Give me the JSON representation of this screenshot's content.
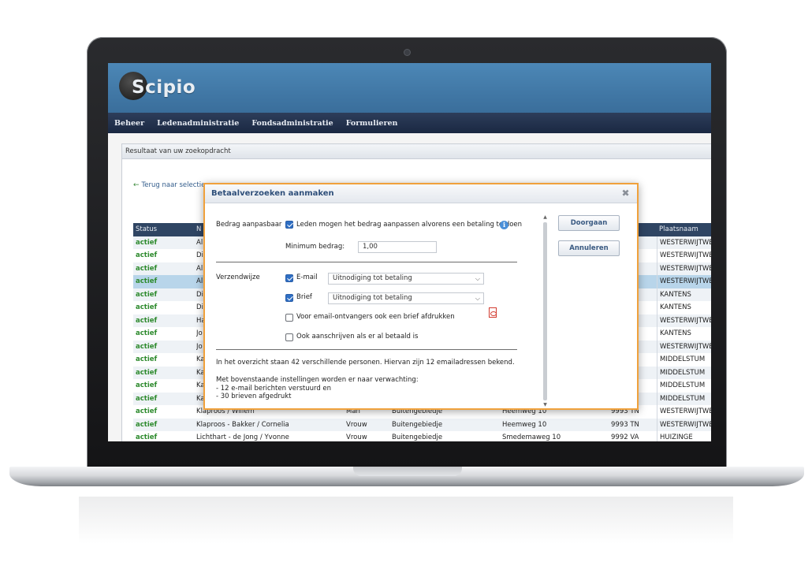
{
  "app": {
    "logo_text": "Scipio"
  },
  "nav": [
    "Beheer",
    "Ledenadministratie",
    "Fondsadministratie",
    "Formulieren"
  ],
  "results": {
    "header": "Resultaat van uw zoekopdracht",
    "back_link": "Terug naar selectie"
  },
  "table": {
    "columns": {
      "status": "Status",
      "name": "N",
      "city": "Plaatsnaam"
    },
    "rows": [
      {
        "status": "actief",
        "name": "Al",
        "gender": "",
        "tag": "",
        "address": "",
        "zip": "",
        "city": "WESTERWIJTWER"
      },
      {
        "status": "actief",
        "name": "Di",
        "gender": "",
        "tag": "",
        "address": "",
        "zip": "",
        "city": "WESTERWIJTWER"
      },
      {
        "status": "actief",
        "name": "Al",
        "gender": "",
        "tag": "",
        "address": "",
        "zip": "",
        "city": "WESTERWIJTWER"
      },
      {
        "status": "actief",
        "name": "Al",
        "gender": "",
        "tag": "",
        "address": "",
        "zip": "",
        "city": "WESTERWIJTWER"
      },
      {
        "status": "actief",
        "name": "Di",
        "gender": "",
        "tag": "",
        "address": "",
        "zip": "",
        "city": "KANTENS"
      },
      {
        "status": "actief",
        "name": "Di",
        "gender": "",
        "tag": "",
        "address": "",
        "zip": "",
        "city": "KANTENS"
      },
      {
        "status": "actief",
        "name": "Ha",
        "gender": "",
        "tag": "",
        "address": "",
        "zip": "",
        "city": "WESTERWIJTWER"
      },
      {
        "status": "actief",
        "name": "Jo",
        "gender": "",
        "tag": "",
        "address": "",
        "zip": "",
        "city": "KANTENS"
      },
      {
        "status": "actief",
        "name": "Jo",
        "gender": "",
        "tag": "",
        "address": "",
        "zip": "",
        "city": "WESTERWIJTWER"
      },
      {
        "status": "actief",
        "name": "Ka",
        "gender": "",
        "tag": "",
        "address": "",
        "zip": "",
        "city": "MIDDELSTUM"
      },
      {
        "status": "actief",
        "name": "Ka",
        "gender": "",
        "tag": "",
        "address": "",
        "zip": "",
        "city": "MIDDELSTUM"
      },
      {
        "status": "actief",
        "name": "Ka",
        "gender": "",
        "tag": "",
        "address": "",
        "zip": "",
        "city": "MIDDELSTUM"
      },
      {
        "status": "actief",
        "name": "Ka",
        "gender": "",
        "tag": "",
        "address": "",
        "zip": "",
        "city": "MIDDELSTUM"
      },
      {
        "status": "actief",
        "name": "Klaproos / Willem",
        "gender": "Man",
        "tag": "Buitengebiedje",
        "address": "Heemweg 10",
        "zip": "9993 TN",
        "city": "WESTERWIJTWER"
      },
      {
        "status": "actief",
        "name": "Klaproos - Bakker / Cornelia",
        "gender": "Vrouw",
        "tag": "Buitengebiedje",
        "address": "Heemweg 10",
        "zip": "9993 TN",
        "city": "WESTERWIJTWER"
      },
      {
        "status": "actief",
        "name": "Lichthart - de Jong / Yvonne",
        "gender": "Vrouw",
        "tag": "Buitengebiedje",
        "address": "Smedemaweg 10",
        "zip": "9992 VA",
        "city": "HUIZINGE"
      }
    ]
  },
  "modal": {
    "title": "Betaalverzoeken aanmaken",
    "bedrag_label": "Bedrag aanpasbaar",
    "bedrag_check": "Leden mogen het bedrag aanpassen alvorens een betaling te doen",
    "minimum_label": "Minimum bedrag:",
    "minimum_value": "1,00",
    "verzend_label": "Verzendwijze",
    "email_label": "E-mail",
    "email_option": "Uitnodiging tot betaling",
    "brief_label": "Brief",
    "brief_option": "Uitnodiging tot betaling",
    "extra_brief": "Voor email-ontvangers ook een brief afdrukken",
    "ook_betaald": "Ook aanschrijven als er al betaald is",
    "summary": "In het overzicht staan 42 verschillende personen. Hiervan zijn 12 emailadressen bekend.",
    "expect_intro": "Met bovenstaande instellingen worden er naar verwachting:",
    "expect_line1": "- 12 e-mail berichten verstuurd en",
    "expect_line2": "- 30 brieven afgedrukt",
    "btn_continue": "Doorgaan",
    "btn_cancel": "Annuleren"
  }
}
